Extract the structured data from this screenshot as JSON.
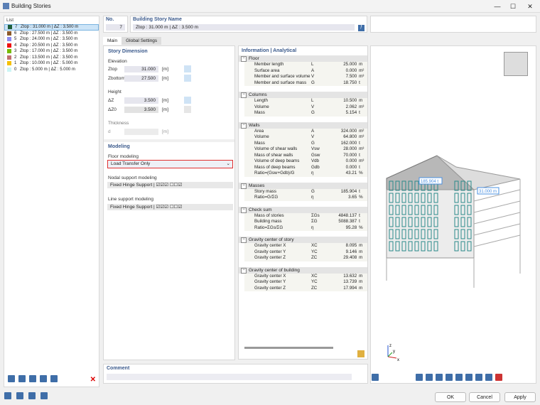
{
  "window": {
    "title": "Building Stories",
    "min": "—",
    "max": "☐",
    "close": "✕"
  },
  "list": {
    "header": "List",
    "items": [
      {
        "no": "7",
        "text": "Ztop : 31.000 m | ΔZ : 3.500 m",
        "color": "#1e5e3a"
      },
      {
        "no": "6",
        "text": "Ztop : 27.500 m | ΔZ : 3.500 m",
        "color": "#8b5a2b"
      },
      {
        "no": "5",
        "text": "Ztop : 24.000 m | ΔZ : 3.500 m",
        "color": "#8c8cf0"
      },
      {
        "no": "4",
        "text": "Ztop : 20.500 m | ΔZ : 3.500 m",
        "color": "#ee1111"
      },
      {
        "no": "3",
        "text": "Ztop : 17.000 m | ΔZ : 3.500 m",
        "color": "#77bb00"
      },
      {
        "no": "2",
        "text": "Ztop : 13.500 m | ΔZ : 3.500 m",
        "color": "#c07070"
      },
      {
        "no": "1",
        "text": "Ztop : 10.000 m | ΔZ : 5.000 m",
        "color": "#f5c000"
      },
      {
        "no": "0",
        "text": "Ztop : 5.000 m | ΔZ : 5.000 m",
        "color": "#ccf5f5"
      }
    ]
  },
  "no": {
    "label": "No.",
    "value": "7"
  },
  "name": {
    "label": "Building Story Name",
    "value": "Ztop : 31.000 m | ΔZ : 3.500 m"
  },
  "tabs": [
    "Main",
    "Global Settings"
  ],
  "story": {
    "header": "Story Dimension",
    "elevation": "Elevation",
    "ztop": "Ztop",
    "ztop_v": "31.000",
    "zbot": "Zbottom",
    "zbot_v": "27.500",
    "height": "Height",
    "dz": "ΔZ",
    "dz_v": "3.500",
    "dz0": "ΔZ0",
    "dz0_v": "3.500",
    "thickness": "Thickness",
    "d": "d",
    "d_v": "",
    "unit": "[m]"
  },
  "modeling": {
    "header": "Modeling",
    "floor_label": "Floor modeling",
    "floor_value": "Load Transfer Only",
    "nodal_label": "Nodal support modeling",
    "nodal_value": "Fixed Hinge Support | ☑☑☑ ☐☐☑",
    "line_label": "Line support modeling",
    "line_value": "Fixed Hinge Support | ☑☑☑ ☐☐☑"
  },
  "info": {
    "header": "Information | Analytical",
    "sections": [
      {
        "title": "Floor",
        "rows": [
          [
            "Member length",
            "L",
            "25.000",
            "m"
          ],
          [
            "Surface area",
            "A",
            "0.000",
            "m²"
          ],
          [
            "Member and surface volume",
            "V",
            "7.500",
            "m³"
          ],
          [
            "Member and surface mass",
            "G",
            "18.750",
            "t"
          ]
        ]
      },
      {
        "title": "Columns",
        "rows": [
          [
            "Length",
            "L",
            "10.500",
            "m"
          ],
          [
            "Volume",
            "V",
            "2.062",
            "m³"
          ],
          [
            "Mass",
            "G",
            "5.154",
            "t"
          ]
        ]
      },
      {
        "title": "Walls",
        "rows": [
          [
            "Area",
            "A",
            "324.000",
            "m²"
          ],
          [
            "Volume",
            "V",
            "64.800",
            "m³"
          ],
          [
            "Mass",
            "G",
            "162.000",
            "t"
          ],
          [
            "Volume of shear walls",
            "Vsw",
            "28.000",
            "m³"
          ],
          [
            "Mass of shear walls",
            "Gsw",
            "70.000",
            "t"
          ],
          [
            "Volume of deep beams",
            "Vdb",
            "0.000",
            "m³"
          ],
          [
            "Mass of deep beams",
            "Gdb",
            "0.000",
            "t"
          ],
          [
            "Ratio=(Gsw+Gdb)/G",
            "η",
            "43.21",
            "%"
          ]
        ]
      },
      {
        "title": "Masses",
        "rows": [
          [
            "Story mass",
            "G",
            "185.904",
            "t"
          ],
          [
            "Ratio=G/ΣG",
            "η",
            "3.65",
            "%"
          ]
        ]
      },
      {
        "title": "Check sum",
        "rows": [
          [
            "Mass of stories",
            "ΣGs",
            "4848.137",
            "t"
          ],
          [
            "Building mass",
            "ΣG",
            "5088.387",
            "t"
          ],
          [
            "Ratio=ΣGs/ΣG",
            "η",
            "95.28",
            "%"
          ]
        ]
      },
      {
        "title": "Gravity center of story",
        "rows": [
          [
            "Gravity center X",
            "XC",
            "8.095",
            "m"
          ],
          [
            "Gravity center Y",
            "YC",
            "9.146",
            "m"
          ],
          [
            "Gravity center Z",
            "ZC",
            "29.408",
            "m"
          ]
        ]
      },
      {
        "title": "Gravity center of building",
        "rows": [
          [
            "Gravity center X",
            "XC",
            "13.632",
            "m"
          ],
          [
            "Gravity center Y",
            "YC",
            "13.739",
            "m"
          ],
          [
            "Gravity center Z",
            "ZC",
            "17.994",
            "m"
          ]
        ]
      }
    ]
  },
  "view": {
    "mass_label": "185.904 t",
    "z_label": "31.000 m",
    "axes": [
      "z",
      "y",
      "x"
    ]
  },
  "comment": {
    "label": "Comment",
    "value": ""
  },
  "buttons": {
    "ok": "OK",
    "cancel": "Cancel",
    "apply": "Apply"
  }
}
